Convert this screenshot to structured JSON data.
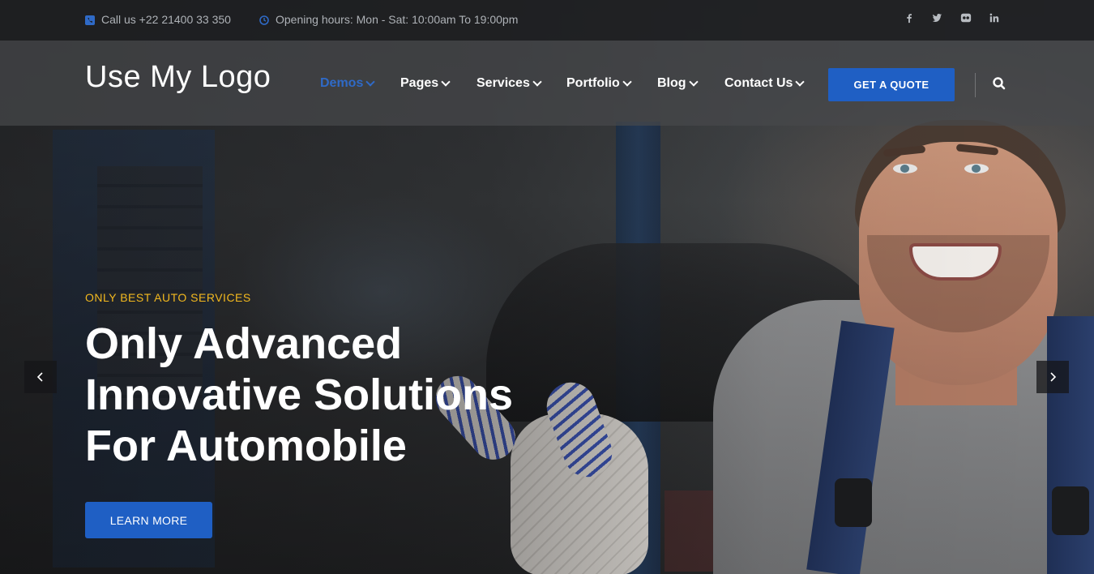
{
  "topbar": {
    "call_text": "Call us +22 21400 33 350",
    "hours_text": "Opening hours: Mon - Sat: 10:00am To 19:00pm",
    "social": [
      "facebook-icon",
      "twitter-icon",
      "flickr-icon",
      "linkedin-icon"
    ]
  },
  "header": {
    "logo": "Use My Logo",
    "nav": [
      {
        "label": "Demos",
        "active": true
      },
      {
        "label": "Pages"
      },
      {
        "label": "Services"
      },
      {
        "label": "Portfolio"
      },
      {
        "label": "Blog"
      },
      {
        "label": "Contact Us"
      }
    ],
    "quote_button": "GET A QUOTE",
    "accent_color": "#1f5fc4"
  },
  "hero": {
    "eyebrow": "ONLY BEST AUTO SERVICES",
    "headline_lines": [
      "Only Advanced",
      "Innovative Solutions",
      "For Automobile"
    ],
    "button": "LEARN MORE",
    "eyebrow_color": "#f2b81e"
  }
}
